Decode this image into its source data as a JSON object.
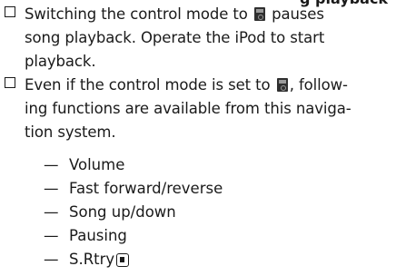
{
  "heading_fragment": "g playback",
  "notes": [
    {
      "lines": [
        {
          "before": "Switching the control mode to ",
          "icon": "ipod-mode-icon",
          "after": " pauses"
        },
        {
          "text": "song playback. Operate the iPod to start"
        },
        {
          "text": "playback."
        }
      ]
    },
    {
      "lines": [
        {
          "before": "Even if the control mode is set to ",
          "icon": "ipod-mode-icon",
          "after": ", follow-"
        },
        {
          "text": "ing functions are available from this naviga-"
        },
        {
          "text": "tion system."
        }
      ]
    }
  ],
  "dash": "—",
  "functions": [
    {
      "label": "Volume"
    },
    {
      "label": "Fast forward/reverse"
    },
    {
      "label": "Song up/down"
    },
    {
      "label": "Pausing"
    },
    {
      "label": "S.Rtry",
      "icon": "stop-button-icon"
    }
  ]
}
